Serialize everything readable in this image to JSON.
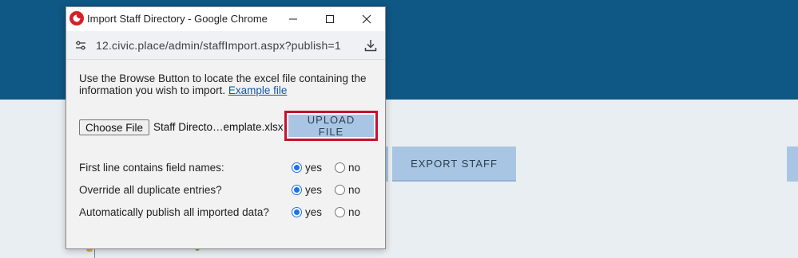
{
  "background": {
    "export_button_label": "EXPORT STAFF"
  },
  "popup": {
    "window_title": "Import Staff Directory - Google Chrome",
    "url": "12.civic.place/admin/staffImport.aspx?publish=1",
    "instructions_text": "Use the Browse Button to locate the excel file containing the information you wish to import.",
    "example_link_label": "Example file",
    "choose_file_label": "Choose File",
    "selected_file_name": "Staff Directo…emplate.xlsx",
    "upload_button_label": "UPLOAD FILE",
    "options": [
      {
        "label": "First line contains field names:",
        "yes_label": "yes",
        "no_label": "no",
        "selected": "yes"
      },
      {
        "label": "Override all duplicate entries?",
        "yes_label": "yes",
        "no_label": "no",
        "selected": "yes"
      },
      {
        "label": "Automatically publish all imported data?",
        "yes_label": "yes",
        "no_label": "no",
        "selected": "yes"
      }
    ]
  },
  "colors": {
    "header_blue": "#0f5784",
    "button_light_blue": "#a8c6e3",
    "highlight_red": "#c8102e",
    "radio_blue": "#1a73e8",
    "link_blue": "#1b56a5"
  },
  "icons": {
    "app": "app-logo-icon",
    "minimize": "minimize-icon",
    "maximize": "maximize-icon",
    "close": "close-icon",
    "site_info": "site-settings-icon",
    "download": "download-icon"
  }
}
